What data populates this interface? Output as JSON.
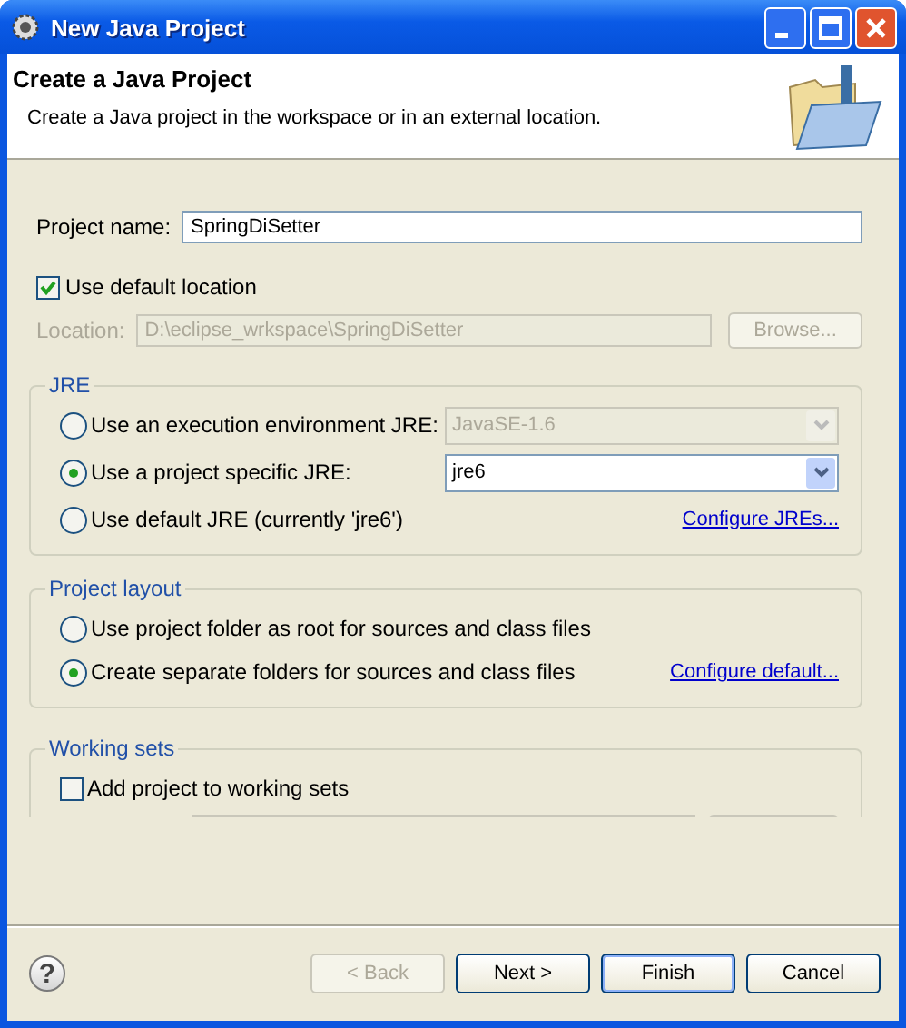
{
  "window": {
    "title": "New Java Project"
  },
  "header": {
    "title": "Create a Java Project",
    "description": "Create a Java project in the workspace or in an external location."
  },
  "project_name": {
    "label": "Project name:",
    "value": "SpringDiSetter"
  },
  "use_default_location": {
    "label": "Use default location",
    "checked": true
  },
  "location": {
    "label": "Location:",
    "value": "D:\\eclipse_wrkspace\\SpringDiSetter",
    "disabled": true,
    "button": "Browse..."
  },
  "jre": {
    "title": "JRE",
    "options": [
      {
        "label": "Use an execution environment JRE:",
        "selected": false,
        "combo": {
          "value": "JavaSE-1.6",
          "disabled": true
        }
      },
      {
        "label": "Use a project specific JRE:",
        "selected": true,
        "combo": {
          "value": "jre6",
          "disabled": false
        }
      },
      {
        "label": "Use default JRE (currently 'jre6')",
        "selected": false,
        "link": "Configure JREs..."
      }
    ]
  },
  "project_layout": {
    "title": "Project layout",
    "options": [
      {
        "label": "Use project folder as root for sources and class files",
        "selected": false
      },
      {
        "label": "Create separate folders for sources and class files",
        "selected": true,
        "link": "Configure default..."
      }
    ]
  },
  "working_sets": {
    "title": "Working sets",
    "add": {
      "label": "Add project to working sets",
      "checked": false
    }
  },
  "help": "?",
  "buttons": [
    {
      "label": "< Back",
      "disabled": true,
      "default": false
    },
    {
      "label": "Next >",
      "disabled": false,
      "default": false
    },
    {
      "label": "Finish",
      "disabled": false,
      "default": true
    },
    {
      "label": "Cancel",
      "disabled": false,
      "default": false
    }
  ]
}
